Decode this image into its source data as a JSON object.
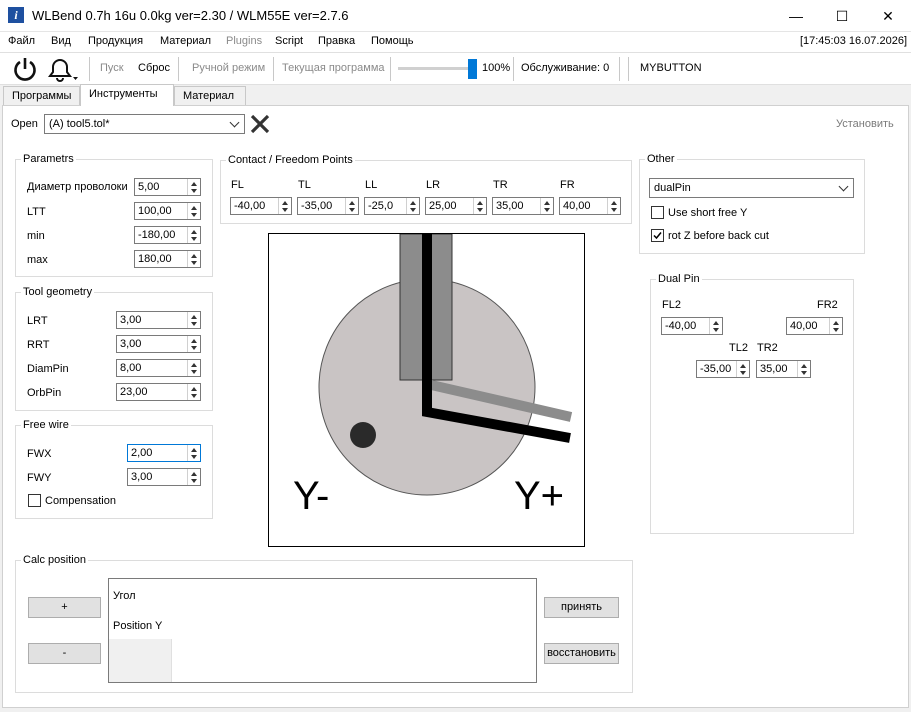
{
  "window": {
    "title": "WLBend 0.7h 16u 0.0kg ver=2.30 / WLM55E ver=2.7.6",
    "app_icon": "i",
    "minimize": "—",
    "maximize": "☐",
    "close": "✕"
  },
  "menu": {
    "items": [
      "Файл",
      "Вид",
      "Продукция",
      "Материал",
      "Plugins",
      "Script",
      "Правка",
      "Помощь"
    ],
    "clock": "[17:45:03 16.07.2026]"
  },
  "toolbar": {
    "start": "Пуск",
    "reset": "Сброс",
    "manual_mode": "Ручной режим",
    "current_program": "Текущая программа",
    "speed_value": 100,
    "speed_label": "100%",
    "service": "Обслуживание: 0",
    "mybutton": "MYBUTTON"
  },
  "tabs": [
    "Программы",
    "Инструменты",
    "Материал"
  ],
  "active_tab": 1,
  "open_row": {
    "label": "Open",
    "file": "(A) tool5.tol*",
    "install": "Установить"
  },
  "parametrs": {
    "title": "Parametrs",
    "rows": [
      {
        "label": "Диаметр проволоки",
        "value": "5,00"
      },
      {
        "label": "LTT",
        "value": "100,00"
      },
      {
        "label": "min",
        "value": "-180,00"
      },
      {
        "label": "max",
        "value": "180,00"
      }
    ]
  },
  "tool_geometry": {
    "title": "Tool geometry",
    "rows": [
      {
        "label": "LRT",
        "value": "3,00"
      },
      {
        "label": "RRT",
        "value": "3,00"
      },
      {
        "label": "DiamPin",
        "value": "8,00"
      },
      {
        "label": "OrbPin",
        "value": "23,00"
      }
    ]
  },
  "free_wire": {
    "title": "Free wire",
    "rows": [
      {
        "label": "FWX",
        "value": "2,00"
      },
      {
        "label": "FWY",
        "value": "3,00"
      }
    ],
    "compensation": "Compensation"
  },
  "contact": {
    "title": "Contact / Freedom Points",
    "points": [
      {
        "label": "FL",
        "value": "-40,00"
      },
      {
        "label": "TL",
        "value": "-35,00"
      },
      {
        "label": "LL",
        "value": "-25,0"
      },
      {
        "label": "LR",
        "value": "25,00"
      },
      {
        "label": "TR",
        "value": "35,00"
      },
      {
        "label": "FR",
        "value": "40,00"
      }
    ]
  },
  "preview": {
    "y_minus": "Y-",
    "y_plus": "Y+"
  },
  "other": {
    "title": "Other",
    "mode": "dualPin",
    "use_short_free_y": "Use short free Y",
    "use_short_free_y_checked": false,
    "rot_z": "rot Z before back cut",
    "rot_z_checked": true
  },
  "dual_pin": {
    "title": "Dual Pin",
    "fl2_label": "FL2",
    "fl2": "-40,00",
    "fr2_label": "FR2",
    "fr2": "40,00",
    "tl2_label": "TL2",
    "tl2": "-35,00",
    "tr2_label": "TR2",
    "tr2": "35,00"
  },
  "calc": {
    "title": "Calc position",
    "plus": "+",
    "minus": "-",
    "row_angle": "Угол",
    "row_position": "Position Y",
    "accept": "принять",
    "restore": "восстановить"
  },
  "colors": {
    "accent": "#0078d7",
    "close_icon": "#333333",
    "disc": "#c9c4c4"
  }
}
